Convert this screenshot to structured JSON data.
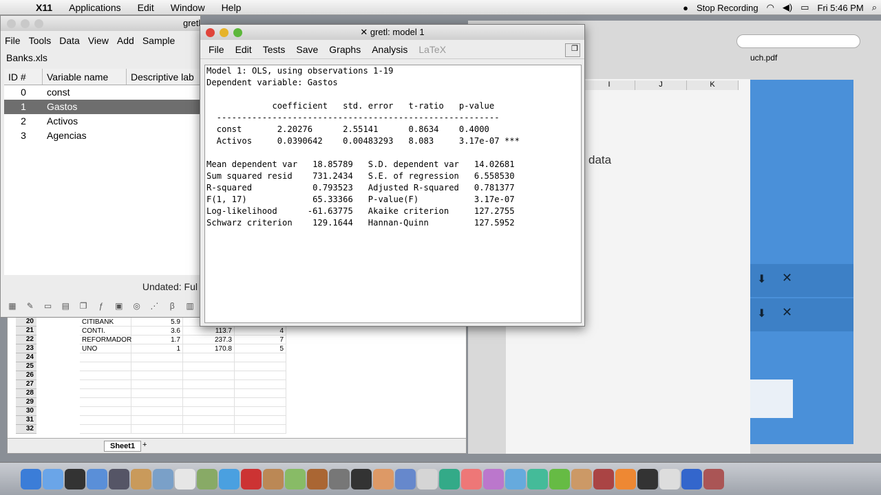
{
  "menubar": {
    "app": "X11",
    "items": [
      "Applications",
      "Edit",
      "Window",
      "Help"
    ],
    "stop_recording": "Stop Recording",
    "clock": "Fri 5:46 PM"
  },
  "gretl_main": {
    "title": "gretl",
    "menu": [
      "File",
      "Tools",
      "Data",
      "View",
      "Add",
      "Sample"
    ],
    "file_label": "Banks.xls",
    "columns": [
      "ID #",
      "Variable name",
      "Descriptive lab"
    ],
    "variables": [
      {
        "id": "0",
        "name": "const"
      },
      {
        "id": "1",
        "name": "Gastos"
      },
      {
        "id": "2",
        "name": "Activos"
      },
      {
        "id": "3",
        "name": "Agencias"
      }
    ],
    "status": "Undated: Ful"
  },
  "model_window": {
    "title": "gretl: model 1",
    "menu": [
      "File",
      "Edit",
      "Tests",
      "Save",
      "Graphs",
      "Analysis",
      "LaTeX"
    ],
    "output_lines": [
      "Model 1: OLS, using observations 1-19",
      "Dependent variable: Gastos",
      "",
      "             coefficient   std. error   t-ratio   p-value",
      "  --------------------------------------------------------",
      "  const       2.20276      2.55141      0.8634    0.4000",
      "  Activos     0.0390642    0.00483293   8.083     3.17e-07 ***",
      "",
      "Mean dependent var   18.85789   S.D. dependent var   14.02681",
      "Sum squared resid    731.2434   S.E. of regression   6.558530",
      "R-squared            0.793523   Adjusted R-squared   0.781377",
      "F(1, 17)             65.33366   P-value(F)           3.17e-07",
      "Log-likelihood      -61.63775   Akaike criterion     127.2755",
      "Schwarz criterion    129.1644   Hannan-Quinn         127.5952"
    ]
  },
  "spreadsheet": {
    "rows": [
      {
        "n": "20",
        "name": "CITIBANK",
        "a": "5.9",
        "b": "",
        "c": ""
      },
      {
        "n": "21",
        "name": "CONTI.",
        "a": "3.6",
        "b": "113.7",
        "c": "4"
      },
      {
        "n": "22",
        "name": "REFORMADOR",
        "a": "1.7",
        "b": "237.3",
        "c": "7"
      },
      {
        "n": "23",
        "name": "UNO",
        "a": "1",
        "b": "170.8",
        "c": "5"
      },
      {
        "n": "24",
        "name": "",
        "a": "",
        "b": "",
        "c": ""
      },
      {
        "n": "25",
        "name": "",
        "a": "",
        "b": "",
        "c": ""
      },
      {
        "n": "26",
        "name": "",
        "a": "",
        "b": "",
        "c": ""
      },
      {
        "n": "27",
        "name": "",
        "a": "",
        "b": "",
        "c": ""
      },
      {
        "n": "28",
        "name": "",
        "a": "",
        "b": "",
        "c": ""
      },
      {
        "n": "29",
        "name": "",
        "a": "",
        "b": "",
        "c": ""
      },
      {
        "n": "30",
        "name": "",
        "a": "",
        "b": "",
        "c": ""
      },
      {
        "n": "31",
        "name": "",
        "a": "",
        "b": "",
        "c": ""
      },
      {
        "n": "32",
        "name": "",
        "a": "",
        "b": "",
        "c": ""
      }
    ],
    "sheet_tab": "Sheet1"
  },
  "right_window": {
    "filename": "uch.pdf",
    "columns": [
      "I",
      "J",
      "K"
    ],
    "text": "data"
  }
}
